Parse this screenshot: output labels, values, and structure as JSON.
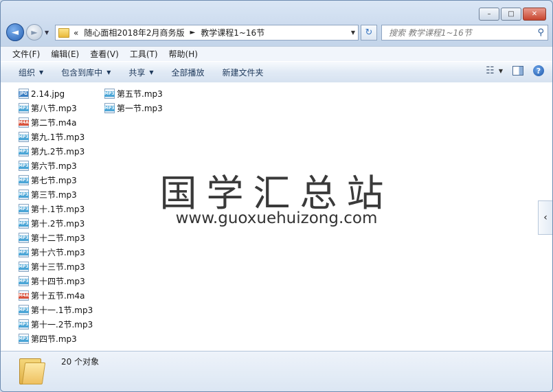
{
  "window": {
    "caption_buttons": {
      "minimize": "–",
      "maximize": "□",
      "close": "✕"
    }
  },
  "nav": {
    "back_icon": "back-arrow-icon",
    "forward_icon": "forward-arrow-icon",
    "address": {
      "overflow": "«",
      "crumbs": [
        "随心面相2018年2月商务版",
        "教学课程1~16节"
      ],
      "separator": "►"
    },
    "search_placeholder": "搜索 教学课程1~16节"
  },
  "menu": [
    "文件(F)",
    "编辑(E)",
    "查看(V)",
    "工具(T)",
    "帮助(H)"
  ],
  "toolbar": {
    "organize": "组织",
    "include_library": "包含到库中",
    "share": "共享",
    "play_all": "全部播放",
    "new_folder": "新建文件夹"
  },
  "files_col1": [
    {
      "name": "2.14.jpg",
      "type": "JPG"
    },
    {
      "name": "第八节.mp3",
      "type": "MP3"
    },
    {
      "name": "第二节.m4a",
      "type": "M4A"
    },
    {
      "name": "第九.1节.mp3",
      "type": "MP3"
    },
    {
      "name": "第九.2节.mp3",
      "type": "MP3"
    },
    {
      "name": "第六节.mp3",
      "type": "MP3"
    },
    {
      "name": "第七节.mp3",
      "type": "MP3"
    },
    {
      "name": "第三节.mp3",
      "type": "MP3"
    },
    {
      "name": "第十.1节.mp3",
      "type": "MP3"
    },
    {
      "name": "第十.2节.mp3",
      "type": "MP3"
    },
    {
      "name": "第十二节.mp3",
      "type": "MP3"
    },
    {
      "name": "第十六节.mp3",
      "type": "MP3"
    },
    {
      "name": "第十三节.mp3",
      "type": "MP3"
    },
    {
      "name": "第十四节.mp3",
      "type": "MP3"
    },
    {
      "name": "第十五节.m4a",
      "type": "M4A"
    },
    {
      "name": "第十一.1节.mp3",
      "type": "MP3"
    },
    {
      "name": "第十一.2节.mp3",
      "type": "MP3"
    },
    {
      "name": "第四节.mp3",
      "type": "MP3"
    }
  ],
  "files_col2": [
    {
      "name": "第五节.mp3",
      "type": "MP3"
    },
    {
      "name": "第一节.mp3",
      "type": "MP3"
    }
  ],
  "watermark": {
    "title": "国学汇总站",
    "url": "www.guoxuehuizong.com"
  },
  "details": {
    "item_count": "20 个对象"
  }
}
